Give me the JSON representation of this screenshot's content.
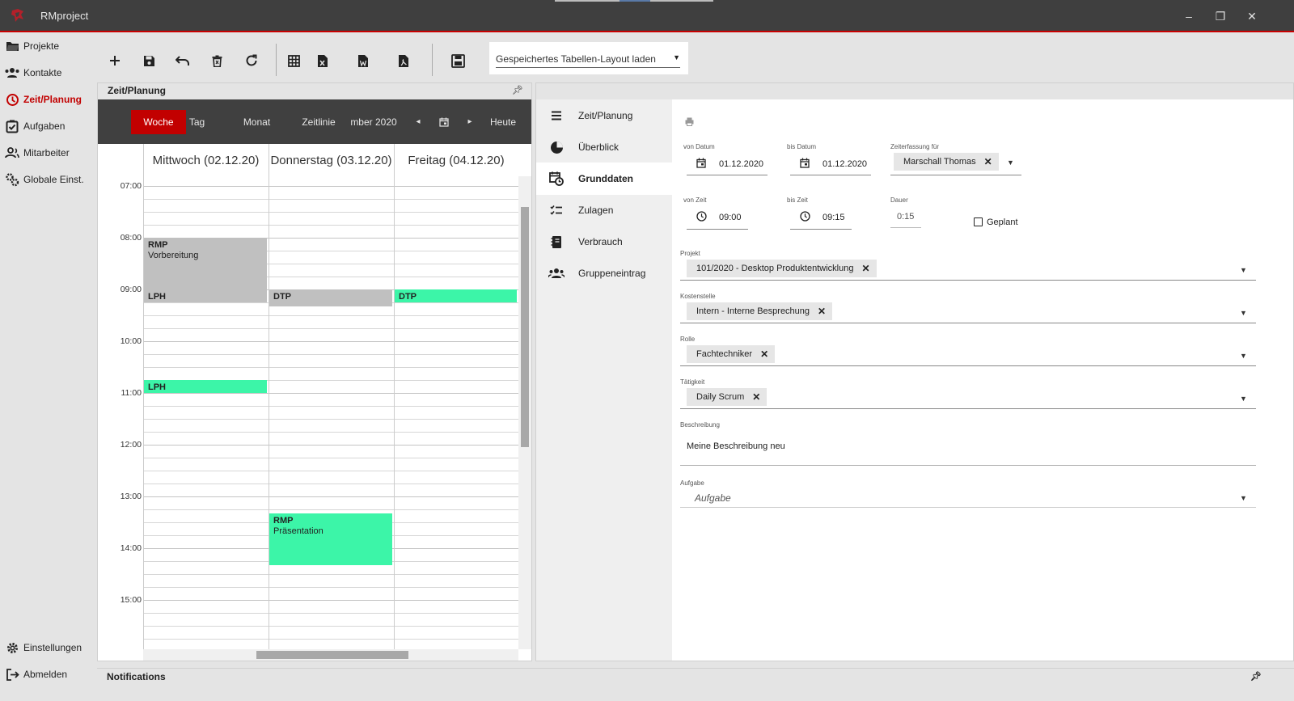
{
  "window": {
    "title": "RMproject",
    "minimize": "–",
    "restore": "❐",
    "close": "✕"
  },
  "nav": {
    "items": [
      {
        "label": "Projekte",
        "icon": "folder-icon"
      },
      {
        "label": "Kontakte",
        "icon": "contacts-icon"
      },
      {
        "label": "Zeit/Planung",
        "icon": "clock-icon",
        "active": true
      },
      {
        "label": "Aufgaben",
        "icon": "tasks-icon"
      },
      {
        "label": "Mitarbeiter",
        "icon": "employees-icon"
      },
      {
        "label": "Globale Einst.",
        "icon": "global-settings-icon"
      }
    ],
    "bottom": [
      {
        "label": "Einstellungen",
        "icon": "gear-icon"
      },
      {
        "label": "Abmelden",
        "icon": "logout-icon"
      }
    ]
  },
  "toolbar": {
    "layout_select": "Gespeichertes Tabellen-Layout laden"
  },
  "calendar": {
    "panel_title": "Zeit/Planung",
    "views": [
      "Woche",
      "Tag",
      "Monat",
      "Zeitlinie"
    ],
    "active_view": "Woche",
    "period": "mber 2020",
    "today": "Heute",
    "days": [
      "Mittwoch (02.12.20)",
      "Donnerstag (03.12.20)",
      "Freitag (04.12.20)"
    ],
    "times": [
      "07:00",
      "08:00",
      "09:00",
      "10:00",
      "11:00",
      "12:00",
      "13:00",
      "14:00",
      "15:00"
    ],
    "events": [
      {
        "line1": "RMP",
        "line2": "Vorbereitung",
        "color": "#c0c0c0"
      },
      {
        "line1": "LPH",
        "line2": "",
        "color": "#c0c0c0"
      },
      {
        "line1": "DTP",
        "line2": "",
        "color": "#c0c0c0"
      },
      {
        "line1": "DTP",
        "line2": "",
        "color": "#3cf5a8"
      },
      {
        "line1": "LPH",
        "line2": "",
        "color": "#3cf5a8"
      },
      {
        "line1": "RMP",
        "line2": "Präsentation",
        "color": "#3cf5a8"
      }
    ]
  },
  "detail": {
    "tabs": [
      {
        "label": "Zeit/Planung",
        "icon": "menu-icon"
      },
      {
        "label": "Überblick",
        "icon": "pie-chart-icon"
      },
      {
        "label": "Grunddaten",
        "icon": "calendar-clock-icon",
        "active": true
      },
      {
        "label": "Zulagen",
        "icon": "checklist-icon"
      },
      {
        "label": "Verbrauch",
        "icon": "notebook-icon"
      },
      {
        "label": "Gruppeneintrag",
        "icon": "group-icon"
      }
    ],
    "form": {
      "von_datum_label": "von Datum",
      "von_datum": "01.12.2020",
      "bis_datum_label": "bis Datum",
      "bis_datum": "01.12.2020",
      "zeiterfassung_label": "Zeiterfassung für",
      "zeiterfassung": "Marschall Thomas",
      "von_zeit_label": "von Zeit",
      "von_zeit": "09:00",
      "bis_zeit_label": "bis Zeit",
      "bis_zeit": "09:15",
      "dauer_label": "Dauer",
      "dauer": "0:15",
      "geplant_label": "Geplant",
      "projekt_label": "Projekt",
      "projekt": "101/2020 - Desktop Produktentwicklung",
      "kostenstelle_label": "Kostenstelle",
      "kostenstelle": "Intern - Interne Besprechung",
      "rolle_label": "Rolle",
      "rolle": "Fachtechniker",
      "taetigkeit_label": "Tätigkeit",
      "taetigkeit": "Daily Scrum",
      "beschreibung_label": "Beschreibung",
      "beschreibung": "Meine Beschreibung neu",
      "aufgabe_label": "Aufgabe",
      "aufgabe_placeholder": "Aufgabe"
    }
  },
  "notifications": {
    "title": "Notifications"
  },
  "colors": {
    "accent": "#c20000",
    "event_green": "#3cf5a8",
    "event_gray": "#c0c0c0",
    "titlebar": "#3f3f3f"
  }
}
